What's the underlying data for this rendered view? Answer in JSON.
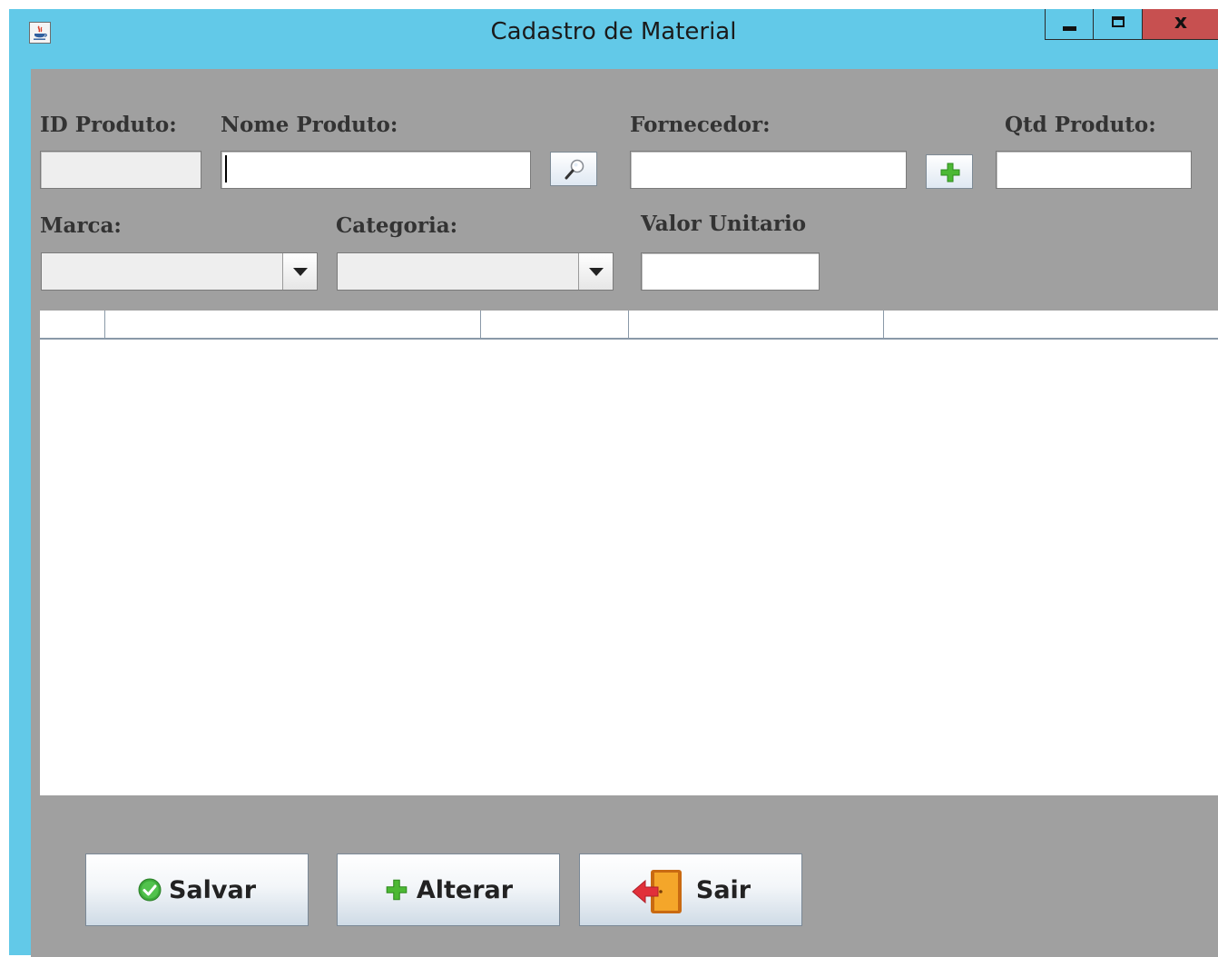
{
  "window": {
    "title": "Cadastro de Material",
    "controls": {
      "minimize": "minimize",
      "maximize": "maximize",
      "close": "x"
    }
  },
  "form": {
    "id_produto": {
      "label": "ID Produto:",
      "value": ""
    },
    "nome_produto": {
      "label": "Nome Produto:",
      "value": ""
    },
    "fornecedor": {
      "label": "Fornecedor:",
      "value": ""
    },
    "qtd_produto": {
      "label": "Qtd Produto:",
      "value": ""
    },
    "marca": {
      "label": "Marca:",
      "selected": ""
    },
    "categoria": {
      "label": "Categoria:",
      "selected": ""
    },
    "valor_unitario": {
      "label": "Valor Unitario",
      "value": ""
    }
  },
  "table": {
    "columns": [
      "",
      "",
      "",
      "",
      ""
    ],
    "rows": []
  },
  "actions": {
    "salvar": "Salvar",
    "alterar": "Alterar",
    "sair": "Sair"
  },
  "icons": {
    "search": "magnifier-icon",
    "add": "plus-icon",
    "save": "check-circle-icon",
    "edit": "plus-icon",
    "exit": "door-exit-icon"
  },
  "colors": {
    "titlebar": "#62c9e8",
    "panel": "#a0a0a0",
    "close": "#c75050",
    "label": "#333333"
  }
}
